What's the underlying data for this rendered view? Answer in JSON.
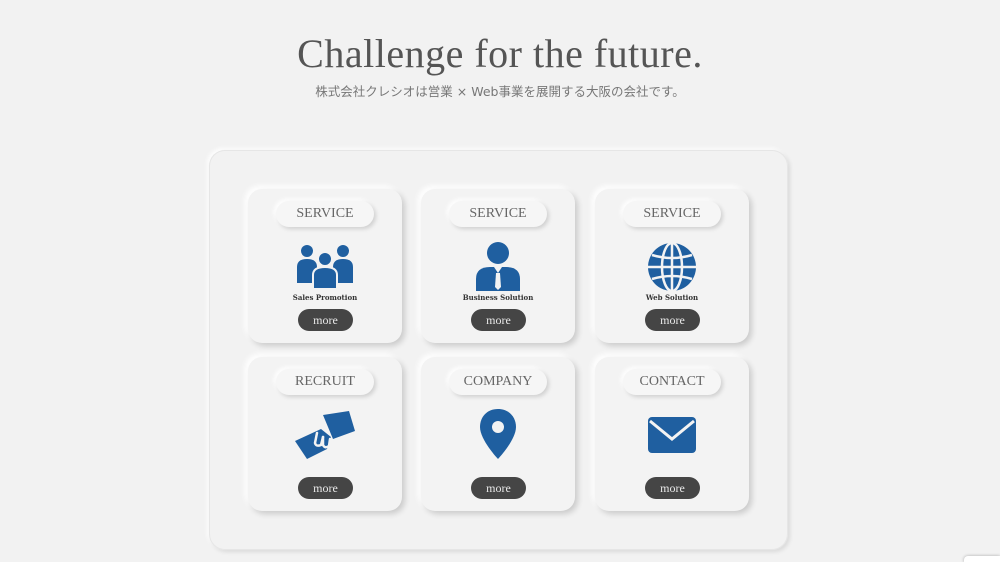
{
  "hero": {
    "title": "Challenge for the future.",
    "subtitle": "株式会社クレシオは営業 × Web事業を展開する大阪の会社です。"
  },
  "colors": {
    "icon_blue": "#1f5fa0",
    "button_dark": "#454545",
    "background": "#f2f2f2"
  },
  "cards": [
    {
      "label": "SERVICE",
      "icon": "team-icon",
      "caption": "Sales Promotion",
      "button": "more"
    },
    {
      "label": "SERVICE",
      "icon": "businessman-icon",
      "caption": "Business Solution",
      "button": "more"
    },
    {
      "label": "SERVICE",
      "icon": "globe-icon",
      "caption": "Web Solution",
      "button": "more"
    },
    {
      "label": "RECRUIT",
      "icon": "handshake-icon",
      "caption": "",
      "button": "more"
    },
    {
      "label": "COMPANY",
      "icon": "location-pin-icon",
      "caption": "",
      "button": "more"
    },
    {
      "label": "CONTACT",
      "icon": "envelope-icon",
      "caption": "",
      "button": "more"
    }
  ]
}
